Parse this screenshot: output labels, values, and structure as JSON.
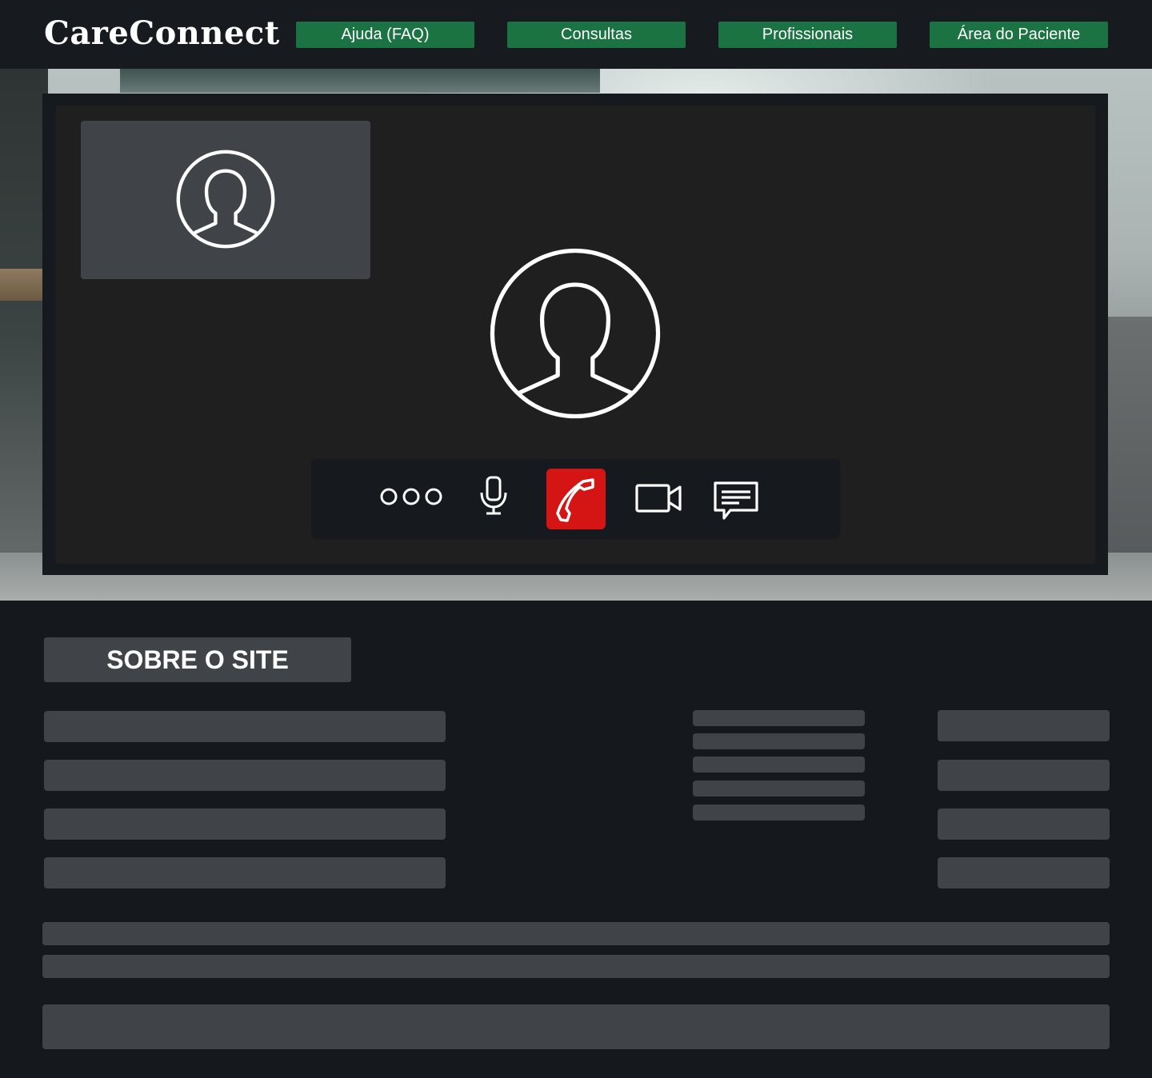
{
  "header": {
    "logo": "CareConnect",
    "nav": [
      {
        "label": "Ajuda (FAQ)"
      },
      {
        "label": "Consultas"
      },
      {
        "label": "Profissionais"
      },
      {
        "label": "Área do Paciente"
      }
    ],
    "nav_color": "#1b7243"
  },
  "call": {
    "controls": {
      "more_icon": "more-options-icon",
      "mic_icon": "microphone-icon",
      "end_icon": "end-call-icon",
      "video_icon": "video-camera-icon",
      "chat_icon": "chat-icon"
    },
    "end_call_color": "#d51414"
  },
  "about": {
    "title": "SOBRE O SITE"
  }
}
